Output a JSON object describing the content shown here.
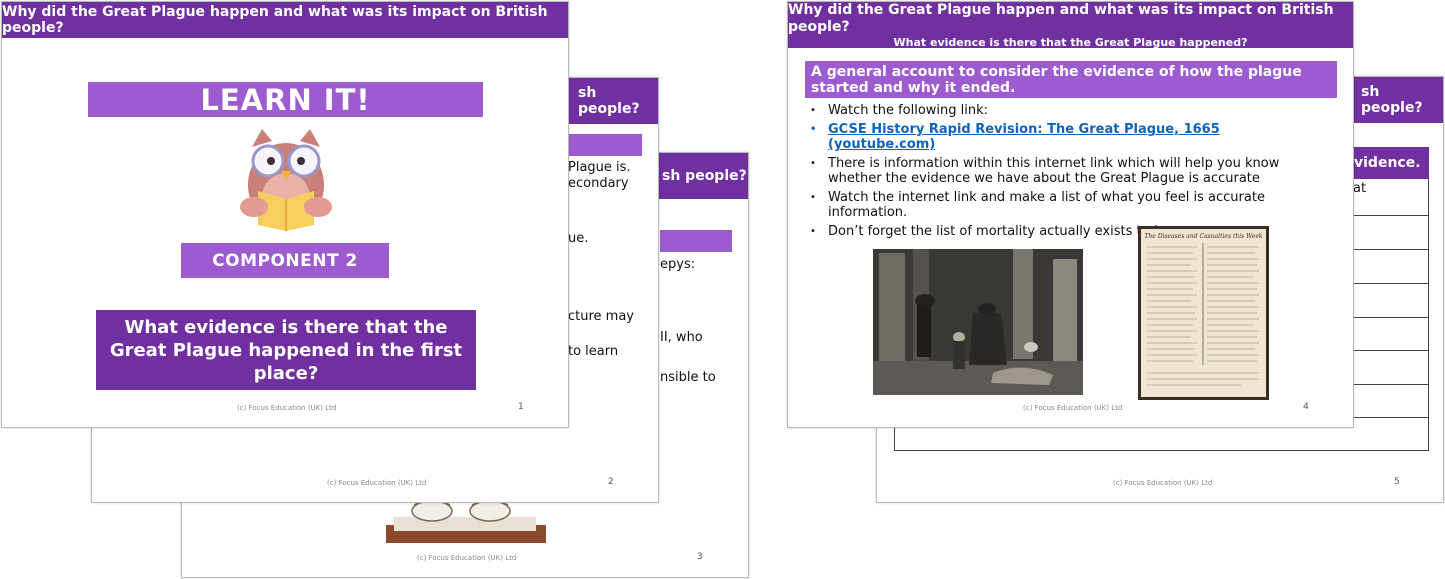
{
  "slides": {
    "s1": {
      "header": "Why did the Great Plague happen and what was its impact on British people?",
      "learn_it": "LEARN IT!",
      "component": "COMPONENT 2",
      "question": "What evidence is there that the Great Plague happened in the first place?",
      "footer": "(c) Focus Education (UK) Ltd",
      "page": "1"
    },
    "s2": {
      "header_fragment": "sh people?",
      "lines": [
        "Plague is.",
        "econdary",
        "ue.",
        "cture may",
        "to learn"
      ],
      "footer": "(c) Focus Education (UK) Ltd",
      "page": "2"
    },
    "s3": {
      "header_fragment": "sh people?",
      "lines": [
        "epys:",
        "II, who",
        "nsible to"
      ],
      "footer": "(c) Focus Education (UK) Ltd",
      "page": "3"
    },
    "s4": {
      "header_line1": "Why did the Great Plague happen and what was its impact on British people?",
      "header_line2": "What evidence is there that the Great Plague happened?",
      "section_title": "A general account to consider the evidence of how the plague started and why it ended.",
      "bullets": [
        "Watch the following link:",
        "GCSE History Rapid Revision: The Great Plague, 1665 (youtube.com)",
        "There is information within this internet link which will help you know whether the evidence we have about the Great Plague is accurate",
        "Watch the internet link and make a list of what you feel is accurate information.",
        "Don’t forget the list of mortality actually exists today."
      ],
      "bill_heading": "The Diseases and Casualties this Week",
      "footer": "(c) Focus Education (UK) Ltd",
      "page": "4"
    },
    "s5": {
      "header_fragment": "sh people?",
      "table_header_fragment": "vidence.",
      "cell_fragment": "at",
      "footer": "(c) Focus Education (UK) Ltd",
      "page": "5"
    }
  },
  "colors": {
    "header_purple": "#7030a0",
    "bar_purple": "#9c5ccf",
    "link_blue": "#0b63c0"
  }
}
